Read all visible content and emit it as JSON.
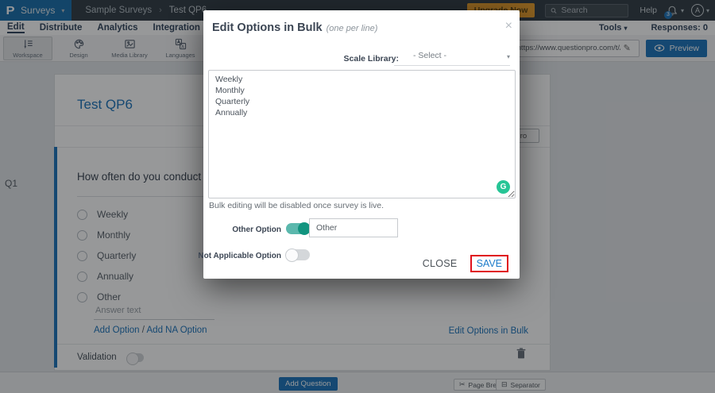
{
  "colors": {
    "accent_blue": "#2076bc",
    "topbar_dark": "#353f47",
    "brand_blue": "#1d71ad",
    "upgrade_orange": "#e89f2e",
    "toggle_teal_track": "#5bb8ad",
    "toggle_teal_knob": "#12947f",
    "grammarly_green": "#27c596",
    "annotation_red": "#e0101c"
  },
  "topbar": {
    "logo": "P",
    "product": "Surveys",
    "caret": "▾",
    "breadcrumb": {
      "parent": "Sample Surveys",
      "separator": "›",
      "current": "Test QP6"
    },
    "upgrade": "Upgrade Now",
    "search_placeholder": "Search",
    "help": "Help",
    "notification_count": "3",
    "avatar_initial": "A"
  },
  "tabbar": {
    "tabs": [
      {
        "label": "Edit"
      },
      {
        "label": "Distribute"
      },
      {
        "label": "Analytics"
      },
      {
        "label": "Integration"
      }
    ],
    "active": "Edit",
    "tools": "Tools",
    "responses": "Responses: 0"
  },
  "toolbar": {
    "buttons": [
      {
        "label": "Workspace"
      },
      {
        "label": "Design"
      },
      {
        "label": "Media Library"
      },
      {
        "label": "Languages"
      }
    ],
    "clipped_text": "d",
    "url": "https://www.questionpro.com/t/APNrfZ",
    "pencil": "✎",
    "preview": "Preview"
  },
  "survey": {
    "title": "Test QP6",
    "corner_button": "ro",
    "question_number": "Q1",
    "question_text": "How often do you conduct the",
    "options": [
      "Weekly",
      "Monthly",
      "Quarterly",
      "Annually",
      "Other"
    ],
    "answer_placeholder": "Answer text",
    "add_option": "Add Option",
    "slash": " / ",
    "add_na_option": "Add NA Option",
    "edit_bulk_link": "Edit Options in Bulk",
    "validation": "Validation"
  },
  "footer": {
    "add_question": "Add Question",
    "page_break": "Page Break",
    "page_break_icon": "✂",
    "separator": "Separator",
    "separator_icon": "⊟"
  },
  "modal": {
    "title": "Edit Options in Bulk",
    "subtitle": "(one per line)",
    "close_x": "×",
    "scale_library_label": "Scale Library:",
    "scale_library_value": "- Select -",
    "caret": "▾",
    "bulk_text": "Weekly\nMonthly\nQuarterly\nAnnually",
    "grammarly_g": "G",
    "note": "Bulk editing will be disabled once survey is live.",
    "other_option_label": "Other Option",
    "other_value": "Other",
    "na_option_label": "Not Applicable Option",
    "close": "CLOSE",
    "save": "SAVE"
  }
}
